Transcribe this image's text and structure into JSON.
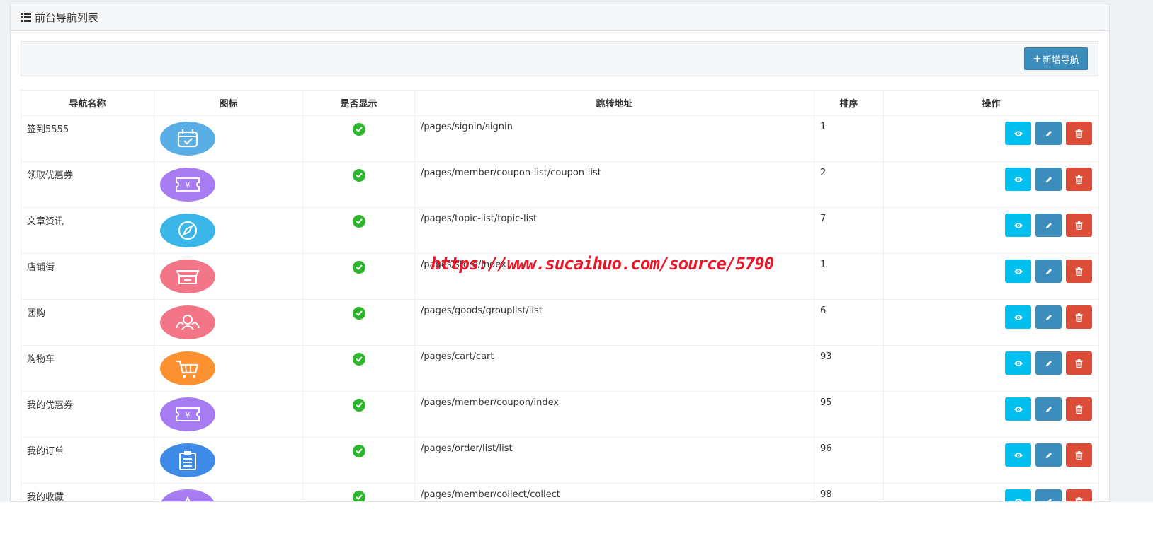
{
  "panel": {
    "title": "前台导航列表",
    "icon": "list-icon"
  },
  "toolbar": {
    "add_label": "新增导航",
    "add_icon": "plus-icon"
  },
  "table": {
    "headers": [
      "导航名称",
      "图标",
      "是否显示",
      "跳转地址",
      "排序",
      "操作"
    ],
    "rows": [
      {
        "name": "签到5555",
        "icon": "calendar-check-icon",
        "icon_color": "#5aaee6",
        "shown": true,
        "url": "/pages/signin/signin",
        "sort": "1"
      },
      {
        "name": "领取优惠券",
        "icon": "coupon-yen-icon",
        "icon_color": "#a77cf2",
        "shown": true,
        "url": "/pages/member/coupon-list/coupon-list",
        "sort": "2"
      },
      {
        "name": "文章资讯",
        "icon": "compass-icon",
        "icon_color": "#3ab6e8",
        "shown": true,
        "url": "/pages/topic-list/topic-list",
        "sort": "7"
      },
      {
        "name": "店铺街",
        "icon": "store-icon",
        "icon_color": "#f37688",
        "shown": true,
        "url": "/pages/store/index",
        "sort": "1"
      },
      {
        "name": "团购",
        "icon": "group-icon",
        "icon_color": "#f37688",
        "shown": true,
        "url": "/pages/goods/grouplist/list",
        "sort": "6"
      },
      {
        "name": "购物车",
        "icon": "cart-icon",
        "icon_color": "#fb9131",
        "shown": true,
        "url": "/pages/cart/cart",
        "sort": "93"
      },
      {
        "name": "我的优惠券",
        "icon": "coupon-yen-icon",
        "icon_color": "#a77cf2",
        "shown": true,
        "url": "/pages/member/coupon/index",
        "sort": "95"
      },
      {
        "name": "我的订单",
        "icon": "clipboard-icon",
        "icon_color": "#3d8be6",
        "shown": true,
        "url": "/pages/order/list/list",
        "sort": "96"
      },
      {
        "name": "我的收藏",
        "icon": "star-icon",
        "icon_color": "#a77cf2",
        "shown": true,
        "url": "/pages/member/collect/collect",
        "sort": "98"
      }
    ]
  },
  "actions": {
    "view_icon": "eye-icon",
    "edit_icon": "pencil-icon",
    "delete_icon": "trash-icon"
  },
  "colors": {
    "view": "#00c0ef",
    "edit": "#3c8dbc",
    "delete": "#dd4b39",
    "check": "#2db52d"
  },
  "watermark": "https://www.sucaihuo.com/source/5790"
}
